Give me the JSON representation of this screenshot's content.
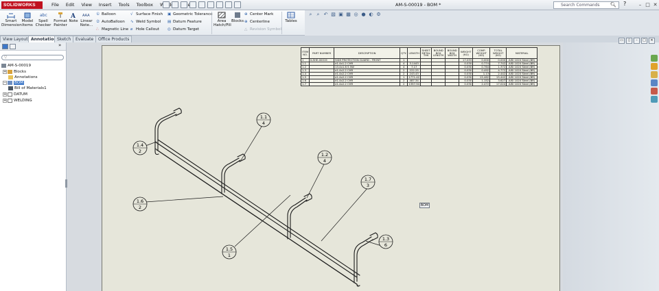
{
  "app": {
    "logo": "SOLIDWORKS",
    "doc_title": "AM-S-00019 - BOM *"
  },
  "menu": [
    "File",
    "Edit",
    "View",
    "Insert",
    "Tools",
    "Toolbox",
    "Window",
    "Help"
  ],
  "search": {
    "placeholder": "Search Commands"
  },
  "ribbon": {
    "smart_dimension": "Smart Dimension",
    "model_items": "Model Items",
    "spell_checker": "Spell Checker",
    "format_painter": "Format Painter",
    "note": "Note",
    "linear_note": "Linear Note...",
    "balloon": "Balloon",
    "autoballoon": "AutoBalloon",
    "magnetic_line": "Magnetic Line",
    "surface_finish": "Surface Finish",
    "weld_symbol": "Weld Symbol",
    "hole_callout": "Hole Callout",
    "geometric_tolerance": "Geometric Tolerance",
    "datum_feature": "Datum Feature",
    "datum_target": "Datum Target",
    "area_hatch": "Area Hatch/Fill",
    "blocks": "Blocks",
    "center_mark": "Center Mark",
    "centerline": "Centerline",
    "revision_symbol": "Revision Symbol",
    "tables": "Tables"
  },
  "tabs": [
    "View Layout",
    "Annotation",
    "Sketch",
    "Evaluate",
    "Office Products"
  ],
  "active_tab": "Annotation",
  "tree": {
    "root": "AM-S-00019",
    "items": [
      "Blocks",
      "Annotations",
      "BOM",
      "Bill of Materials1",
      "DATUM",
      "WELDING"
    ]
  },
  "bom": {
    "headers": [
      "ITEM NO.",
      "PART NUMBER",
      "DESCRIPTION",
      "QTY.",
      "LENGTH",
      "SHEET METAL THK",
      "BOUND BOX LENGTH",
      "BOUND BOX WIDTH",
      "WEIGHT (KG)",
      "COMP. WEIGHT (KG)",
      "TOTAL WEIGHT (KG)",
      "MATERIAL"
    ],
    "rows": [
      [
        "1",
        "K-SHE-00019",
        "SIDE PROTECTION GUARD - FRONT",
        "1",
        "",
        "",
        "",
        "",
        "17.033",
        "0.000",
        "0.000",
        "AISI 1020 Steel (BR)"
      ],
      [
        "1.1",
        "",
        "e1.4x1.2 CHR",
        "4",
        "3.1443",
        "",
        "",
        "",
        "0.030",
        "0.774",
        "7.742",
        "AISI 1020 Steel (BR)"
      ],
      [
        "1.2",
        "",
        "13.4x1.6 S 5W",
        "4",
        "7.17",
        "",
        "",
        "",
        "0.030",
        "0.764",
        "1.372",
        "AISI 1020 Steel (BR)"
      ],
      [
        "1.3",
        "",
        "e1.4x2.2 CHR",
        "2",
        "222.25",
        "",
        "",
        "",
        "0.030",
        "0.492",
        "4.772",
        "AISI 1020 Steel (BR)"
      ],
      [
        "1.4",
        "",
        "e1.4x2.2 CHR",
        "2",
        "243.43",
        "",
        "",
        "",
        "0.030",
        "1.13",
        "2.442",
        "AISI 1020 Steel (BR)"
      ],
      [
        "1.5",
        "",
        "e1.4x2.2 CHR",
        "1",
        "1771.42",
        "",
        "",
        "",
        "0.030",
        "15.462",
        "15.442",
        "AISI 1020 Steel (BR)"
      ],
      [
        "1.6",
        "",
        "e1.4x2.2 CHR",
        "2",
        "487.34",
        "",
        "",
        "",
        "0.030",
        "1.152",
        "3.627",
        "AISI 1020 Steel (BR)"
      ],
      [
        "1.7",
        "",
        "e1.4x2.2 CHR",
        "2",
        "1397.94",
        "",
        "",
        "",
        "0.030",
        "2.472",
        "17.024",
        "AISI 1020 Steel (BR)"
      ]
    ]
  },
  "balloons": [
    {
      "item": "1.1",
      "qty": "4"
    },
    {
      "item": "1.2",
      "qty": "4"
    },
    {
      "item": "1.3",
      "qty": "6"
    },
    {
      "item": "1.4",
      "qty": "2"
    },
    {
      "item": "1.5",
      "qty": "1"
    },
    {
      "item": "1.6",
      "qty": "2"
    },
    {
      "item": "1.7",
      "qty": "3"
    }
  ],
  "bom_tag": "BOM"
}
